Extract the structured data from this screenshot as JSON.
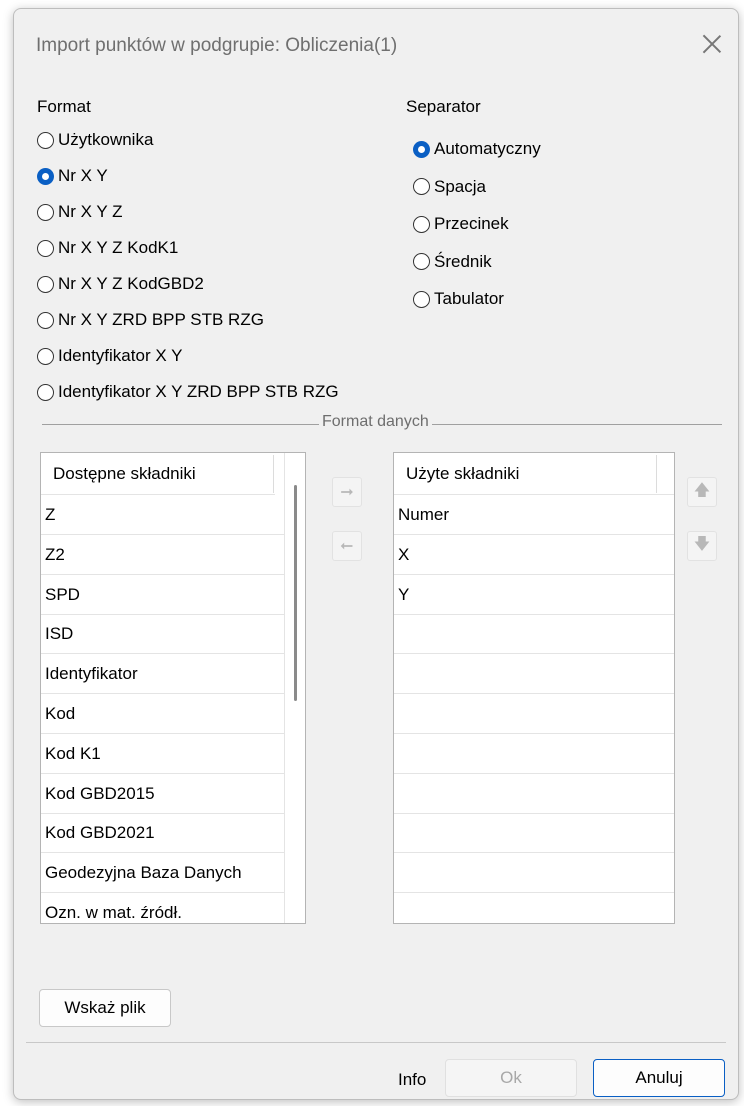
{
  "dialog": {
    "title": "Import punktów w podgrupie: Obliczenia(1)"
  },
  "format": {
    "label": "Format",
    "options": [
      {
        "label": "Użytkownika",
        "checked": false
      },
      {
        "label": "Nr X Y",
        "checked": true
      },
      {
        "label": "Nr X Y Z",
        "checked": false
      },
      {
        "label": "Nr X Y Z KodK1",
        "checked": false
      },
      {
        "label": "Nr X Y Z KodGBD2",
        "checked": false
      },
      {
        "label": "Nr X Y ZRD BPP STB RZG",
        "checked": false
      },
      {
        "label": "Identyfikator X Y",
        "checked": false
      },
      {
        "label": "Identyfikator X Y ZRD BPP STB RZG",
        "checked": false
      }
    ]
  },
  "separator": {
    "label": "Separator",
    "options": [
      {
        "label": "Automatyczny",
        "checked": true
      },
      {
        "label": "Spacja",
        "checked": false
      },
      {
        "label": "Przecinek",
        "checked": false
      },
      {
        "label": "Średnik",
        "checked": false
      },
      {
        "label": "Tabulator",
        "checked": false
      }
    ]
  },
  "data_format": {
    "title": "Format danych",
    "available": {
      "header": "Dostępne składniki",
      "items": [
        "Z",
        "Z2",
        "SPD",
        "ISD",
        "Identyfikator",
        "Kod",
        "Kod K1",
        "Kod GBD2015",
        "Kod GBD2021",
        "Geodezyjna Baza Danych",
        "Ozn. w mat. źródł."
      ]
    },
    "used": {
      "header": "Użyte składniki",
      "items": [
        "Numer",
        "X",
        "Y"
      ]
    },
    "icons": {
      "add": "arrow-right-icon",
      "remove": "arrow-left-icon",
      "up": "arrow-up-icon",
      "down": "arrow-down-icon"
    }
  },
  "buttons": {
    "choose_file": "Wskaż plik",
    "info": "Info",
    "ok": "Ok",
    "cancel": "Anuluj"
  }
}
